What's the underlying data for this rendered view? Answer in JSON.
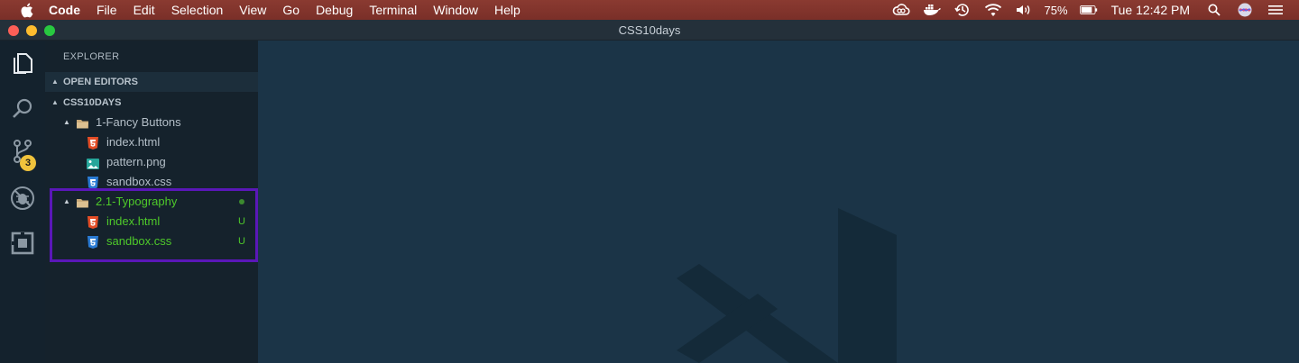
{
  "menubar": {
    "app_name": "Code",
    "items": [
      "File",
      "Edit",
      "Selection",
      "View",
      "Go",
      "Debug",
      "Terminal",
      "Window",
      "Help"
    ],
    "battery": "75%",
    "clock": "Tue 12:42 PM"
  },
  "window": {
    "title": "CSS10days"
  },
  "activity": {
    "scm_badge": "3"
  },
  "sidebar": {
    "title": "EXPLORER",
    "open_editors": "OPEN EDITORS",
    "project": "CSS10DAYS",
    "folder1": {
      "name": "1-Fancy Buttons",
      "files": [
        "index.html",
        "pattern.png",
        "sandbox.css"
      ]
    },
    "folder2": {
      "name": "2.1-Typography",
      "files": [
        {
          "name": "index.html",
          "status": "U"
        },
        {
          "name": "sandbox.css",
          "status": "U"
        }
      ]
    }
  },
  "colors": {
    "menubar": "#7f322a",
    "editor_bg": "#1b3447",
    "sidebar_bg": "#15222c",
    "untracked": "#4ec92a",
    "highlight": "#5a17b8",
    "badge": "#f0c33c"
  }
}
